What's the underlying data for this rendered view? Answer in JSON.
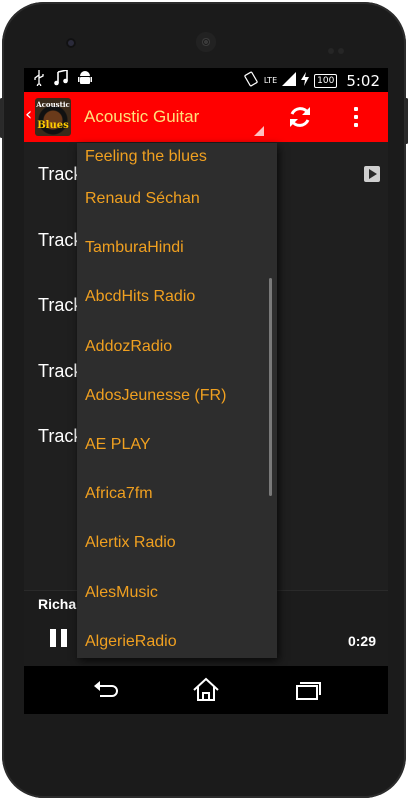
{
  "status_bar": {
    "left_icons": [
      "usb-icon",
      "music-note-icon",
      "android-icon"
    ],
    "network": "LTE",
    "battery": "100",
    "time": "5:02"
  },
  "action_bar": {
    "color": "#ff0000",
    "logo": {
      "line1": "Acoustic",
      "line2": "Blues"
    },
    "spinner_value": "Acoustic Guitar",
    "icons": [
      "refresh-icon",
      "overflow-menu-icon"
    ]
  },
  "track_list": {
    "rows": [
      {
        "label": "Track"
      },
      {
        "label": "Track"
      },
      {
        "label": "Track"
      },
      {
        "label": "Track"
      },
      {
        "label": "Track"
      }
    ]
  },
  "player": {
    "now_playing": "Richar",
    "time": "0:29"
  },
  "dropdown": {
    "items": [
      "Feeling the blues",
      "Renaud Séchan",
      "TamburaHindi",
      "AbcdHits Radio",
      "AddozRadio",
      "AdosJeunesse (FR)",
      "AE PLAY",
      "Africa7fm",
      "Alertix Radio",
      "AlesMusic",
      "AlgerieRadio"
    ],
    "text_color": "#f0a020"
  },
  "nav_bar": {
    "icons": [
      "back-icon",
      "home-icon",
      "recents-icon"
    ]
  }
}
